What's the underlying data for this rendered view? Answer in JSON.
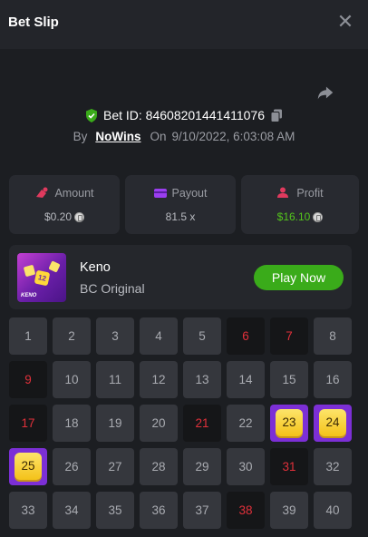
{
  "dialog": {
    "title": "Bet Slip",
    "close_icon": "close-icon"
  },
  "bet": {
    "id_label": "Bet ID:",
    "id_value": "84608201441411076",
    "by_label": "By",
    "user": "NoWins",
    "on_label": "On",
    "date": "9/10/2022, 6:03:08 AM"
  },
  "stats": {
    "amount": {
      "label": "Amount",
      "value": "$0.20"
    },
    "payout": {
      "label": "Payout",
      "value": "81.5 x"
    },
    "profit": {
      "label": "Profit",
      "value": "$16.10"
    }
  },
  "game": {
    "name": "Keno",
    "provider": "BC Original",
    "play_label": "Play Now",
    "thumb_label": "KENO",
    "thumb_number": "12"
  },
  "board": {
    "cells": [
      {
        "n": "1",
        "s": "none"
      },
      {
        "n": "2",
        "s": "none"
      },
      {
        "n": "3",
        "s": "none"
      },
      {
        "n": "4",
        "s": "none"
      },
      {
        "n": "5",
        "s": "none"
      },
      {
        "n": "6",
        "s": "picked"
      },
      {
        "n": "7",
        "s": "picked"
      },
      {
        "n": "8",
        "s": "none"
      },
      {
        "n": "9",
        "s": "picked"
      },
      {
        "n": "10",
        "s": "none"
      },
      {
        "n": "11",
        "s": "none"
      },
      {
        "n": "12",
        "s": "none"
      },
      {
        "n": "13",
        "s": "none"
      },
      {
        "n": "14",
        "s": "none"
      },
      {
        "n": "15",
        "s": "none"
      },
      {
        "n": "16",
        "s": "none"
      },
      {
        "n": "17",
        "s": "picked"
      },
      {
        "n": "18",
        "s": "none"
      },
      {
        "n": "19",
        "s": "none"
      },
      {
        "n": "20",
        "s": "none"
      },
      {
        "n": "21",
        "s": "picked"
      },
      {
        "n": "22",
        "s": "none"
      },
      {
        "n": "23",
        "s": "hit"
      },
      {
        "n": "24",
        "s": "hit"
      },
      {
        "n": "25",
        "s": "hit"
      },
      {
        "n": "26",
        "s": "none"
      },
      {
        "n": "27",
        "s": "none"
      },
      {
        "n": "28",
        "s": "none"
      },
      {
        "n": "29",
        "s": "none"
      },
      {
        "n": "30",
        "s": "none"
      },
      {
        "n": "31",
        "s": "picked"
      },
      {
        "n": "32",
        "s": "none"
      },
      {
        "n": "33",
        "s": "none"
      },
      {
        "n": "34",
        "s": "none"
      },
      {
        "n": "35",
        "s": "none"
      },
      {
        "n": "36",
        "s": "none"
      },
      {
        "n": "37",
        "s": "none"
      },
      {
        "n": "38",
        "s": "picked"
      },
      {
        "n": "39",
        "s": "none"
      },
      {
        "n": "40",
        "s": "none"
      }
    ]
  },
  "colors": {
    "accent_green": "#3aab1a",
    "profit_green": "#54c61c",
    "hit_purple": "#7c2fd6",
    "hit_gold": "#f4c219",
    "pick_red": "#e0303a"
  }
}
